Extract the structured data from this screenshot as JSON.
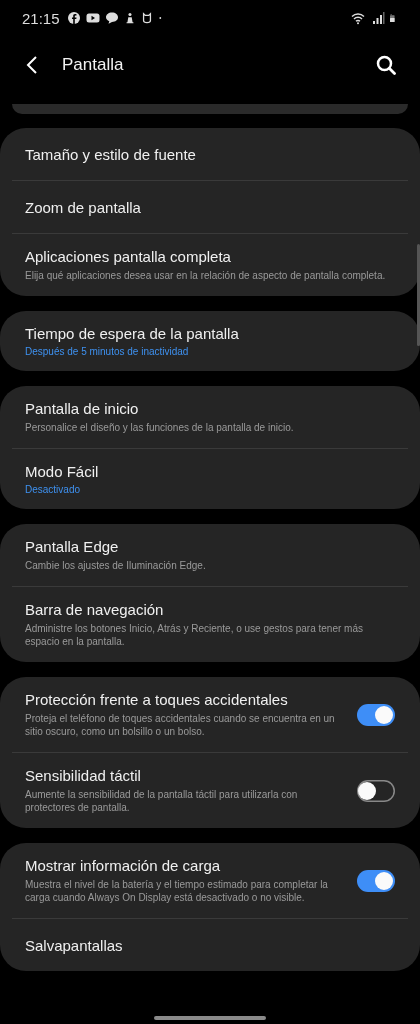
{
  "status_bar": {
    "time": "21:15"
  },
  "header": {
    "title": "Pantalla"
  },
  "groups": [
    {
      "items": [
        {
          "kind": "link",
          "title": "Tamaño y estilo de fuente"
        },
        {
          "kind": "link",
          "title": "Zoom de pantalla"
        },
        {
          "kind": "link",
          "title": "Aplicaciones pantalla completa",
          "description": "Elija qué aplicaciones desea usar en la relación de aspecto de pantalla completa."
        }
      ]
    },
    {
      "items": [
        {
          "kind": "link",
          "title": "Tiempo de espera de la pantalla",
          "summary": "Después de 5 minutos de inactividad"
        }
      ]
    },
    {
      "items": [
        {
          "kind": "link",
          "title": "Pantalla de inicio",
          "description": "Personalice el diseño y las funciones de la pantalla de inicio."
        },
        {
          "kind": "link",
          "title": "Modo Fácil",
          "summary": "Desactivado"
        }
      ]
    },
    {
      "items": [
        {
          "kind": "link",
          "title": "Pantalla Edge",
          "description": "Cambie los ajustes de Iluminación Edge."
        },
        {
          "kind": "link",
          "title": "Barra de navegación",
          "description": "Administre los botones Inicio, Atrás y Reciente, o use gestos para tener más espacio en la pantalla."
        }
      ]
    },
    {
      "items": [
        {
          "kind": "toggle",
          "title": "Protección frente a toques accidentales",
          "description": "Proteja el teléfono de toques accidentales cuando se encuentra en un sitio oscuro, como un bolsillo o un bolso.",
          "on": true
        },
        {
          "kind": "toggle",
          "title": "Sensibilidad táctil",
          "description": "Aumente la sensibilidad de la pantalla táctil para utilizarla con protectores de pantalla.",
          "on": false
        }
      ]
    },
    {
      "items": [
        {
          "kind": "toggle",
          "title": "Mostrar información de carga",
          "description": "Muestra el nivel de la batería y el tiempo estimado para completar la carga cuando Always On Display está desactivado o no visible.",
          "on": true
        },
        {
          "kind": "link",
          "title": "Salvapantallas"
        }
      ]
    }
  ]
}
